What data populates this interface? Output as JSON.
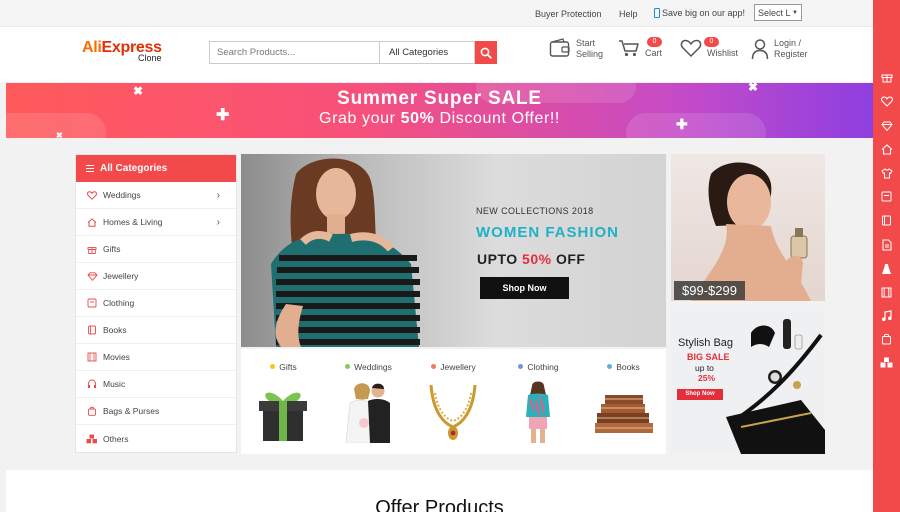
{
  "topbar": {
    "buyer_protection": "Buyer Protection",
    "help": "Help",
    "app_text": "Save big on our app!",
    "language": "Select L"
  },
  "header": {
    "logo_part1": "Ali",
    "logo_part2": "Express",
    "logo_sub": "Clone",
    "search_placeholder": "Search Products...",
    "category_select": "All Categories",
    "start_selling": [
      "Start",
      "Selling"
    ],
    "cart_label": "Cart",
    "cart_count": "0",
    "wishlist_label": "Wishlist",
    "wishlist_count": "0",
    "login": [
      "Login /",
      "Register"
    ]
  },
  "promo": {
    "title": "Summer Super SALE",
    "sub_pre": "Grab your ",
    "sub_pct": "50%",
    "sub_post": " Discount Offer!!"
  },
  "categories": {
    "header": "All Categories",
    "items": [
      {
        "label": "Weddings",
        "icon": "heart-icon",
        "has_arrow": true
      },
      {
        "label": "Homes & Living",
        "icon": "home-icon",
        "has_arrow": true
      },
      {
        "label": "Gifts",
        "icon": "gift-icon",
        "has_arrow": false
      },
      {
        "label": "Jewellery",
        "icon": "diamond-icon",
        "has_arrow": false
      },
      {
        "label": "Clothing",
        "icon": "tag-icon",
        "has_arrow": false
      },
      {
        "label": "Books",
        "icon": "book-icon",
        "has_arrow": false
      },
      {
        "label": "Movies",
        "icon": "film-icon",
        "has_arrow": false
      },
      {
        "label": "Music",
        "icon": "headphones-icon",
        "has_arrow": false
      },
      {
        "label": "Bags & Purses",
        "icon": "bag-icon",
        "has_arrow": false
      },
      {
        "label": "Others",
        "icon": "cubes-icon",
        "has_arrow": false
      }
    ]
  },
  "hero": {
    "new_collections": "NEW COLLECTIONS 2018",
    "title": "WOMEN FASHION",
    "offer_pre": "UPTO ",
    "offer_pct": "50%",
    "offer_post": " OFF",
    "button": "Shop Now"
  },
  "side_banner_1": {
    "price": "$99-$299"
  },
  "side_banner_2": {
    "title": "Stylish Bag",
    "sale": "BIG SALE",
    "upto": "up to",
    "pct": "25%",
    "button": "Shop Now"
  },
  "strip": {
    "items": [
      {
        "label": "Gifts",
        "dot_color": "#f5c518"
      },
      {
        "label": "Weddings",
        "dot_color": "#7ccf5a"
      },
      {
        "label": "Jewellery",
        "dot_color": "#f07a5a"
      },
      {
        "label": "Clothing",
        "dot_color": "#7a8ee0"
      },
      {
        "label": "Books",
        "dot_color": "#5ab4d6"
      }
    ]
  },
  "offer": {
    "title": "Offer Products"
  },
  "colors": {
    "accent": "#f24a4a",
    "teal": "#1eb1c7",
    "sale_red": "#e62e3b"
  }
}
